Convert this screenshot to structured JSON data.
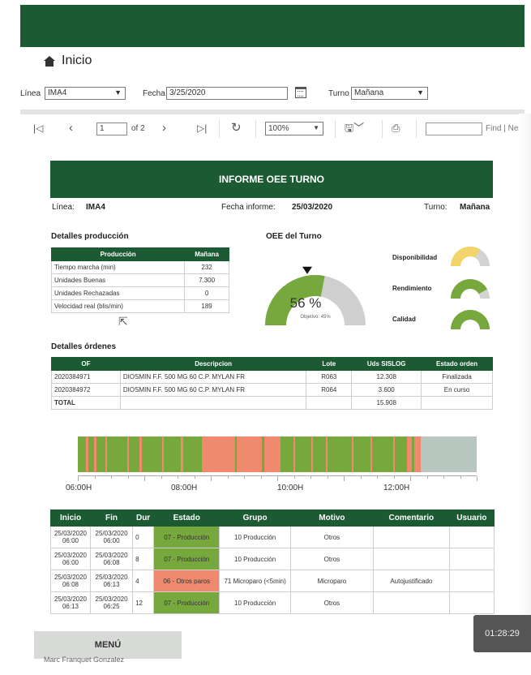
{
  "header": {
    "title": "Inicio",
    "icon": "home-icon"
  },
  "params": {
    "linea_label": "Línea",
    "linea_value": "IMA4",
    "fecha_label": "Fecha",
    "fecha_value": "3/25/2020",
    "turno_label": "Turno",
    "turno_value": "Mañana"
  },
  "toolbar": {
    "page_value": "1",
    "page_of": "of 2",
    "zoom_value": "100%",
    "find_label": "Find | Next"
  },
  "report": {
    "title": "INFORME OEE TURNO",
    "linea_label": "Línea:",
    "linea_value": "IMA4",
    "fecha_label": "Fecha informe:",
    "fecha_value": "25/03/2020",
    "turno_label": "Turno:",
    "turno_value": "Mañana"
  },
  "produccion": {
    "title": "Detalles producción",
    "headers": [
      "Producción",
      "Mañana"
    ],
    "rows": [
      [
        "Tiempo marcha (min)",
        "232"
      ],
      [
        "Unidades Buenas",
        "7.300"
      ],
      [
        "Unidades Rechazadas",
        "0"
      ],
      [
        "Velocidad real (blis/min)",
        "189"
      ]
    ]
  },
  "oee": {
    "title": "OEE del Turno",
    "value_label": "56 %",
    "value": 56,
    "target_label": "Objetivo: 45%",
    "target": 45,
    "small": [
      {
        "label": "Disponibilidad",
        "value": 67,
        "value_label": "67 %",
        "color": "#f2d46a"
      },
      {
        "label": "Rendimiento",
        "value": 84,
        "value_label": "84 %",
        "color": "#77a83d"
      },
      {
        "label": "Calidad",
        "value": 100,
        "value_label": "100 %",
        "color": "#77a83d"
      }
    ]
  },
  "ordenes": {
    "title": "Detalles órdenes",
    "headers": [
      "OF",
      "Descripcion",
      "Lote",
      "Uds SISLOG",
      "Estado orden"
    ],
    "rows": [
      [
        "2020384971",
        "DIOSMIN F.F. 500 MG 60 C.P. MYLAN FR",
        "R063",
        "12.308",
        "Finalizada"
      ],
      [
        "2020384972",
        "DIOSMIN F.F. 500 MG 60 C.P. MYLAN FR",
        "R064",
        "3.600",
        "En curso"
      ]
    ],
    "total_label": "TOTAL",
    "total_value": "15.908"
  },
  "timeline": {
    "axis_labels": [
      "06:00H",
      "08:00H",
      "10:00H",
      "12:00H"
    ],
    "colors": {
      "produccion": "#77a83d",
      "paro": "#f08a6e",
      "sin_datos": "#b8c6c0"
    }
  },
  "eventos": {
    "headers": [
      "Inicio",
      "Fin",
      "Dur",
      "Estado",
      "Grupo",
      "Motivo",
      "Comentario",
      "Usuario"
    ],
    "rows": [
      {
        "inicio": "25/03/2020 06:00",
        "fin": "25/03/2020 06:00",
        "dur": "0",
        "estado": "07 - Producción",
        "tipo": "prod",
        "grupo": "10 Producción",
        "motivo": "Otros",
        "comentario": "",
        "usuario": ""
      },
      {
        "inicio": "25/03/2020 06:00",
        "fin": "25/03/2020 06:08",
        "dur": "8",
        "estado": "07 - Producción",
        "tipo": "prod",
        "grupo": "10 Producción",
        "motivo": "Otros",
        "comentario": "",
        "usuario": ""
      },
      {
        "inicio": "25/03/2020 06:08",
        "fin": "25/03/2020 06:13",
        "dur": "4",
        "estado": "06 - Otros paros",
        "tipo": "paro",
        "grupo": "71 Microparo (<5min)",
        "motivo": "Microparo",
        "comentario": "Autojustificado",
        "usuario": ""
      },
      {
        "inicio": "25/03/2020 06:13",
        "fin": "25/03/2020 06:25",
        "dur": "12",
        "estado": "07 - Producción",
        "tipo": "prod",
        "grupo": "10 Producción",
        "motivo": "Otros",
        "comentario": "",
        "usuario": ""
      }
    ]
  },
  "footer": {
    "menu_label": "MENÚ",
    "author": "Marc Franquet Gonzalez",
    "timer": "01:28:29"
  }
}
